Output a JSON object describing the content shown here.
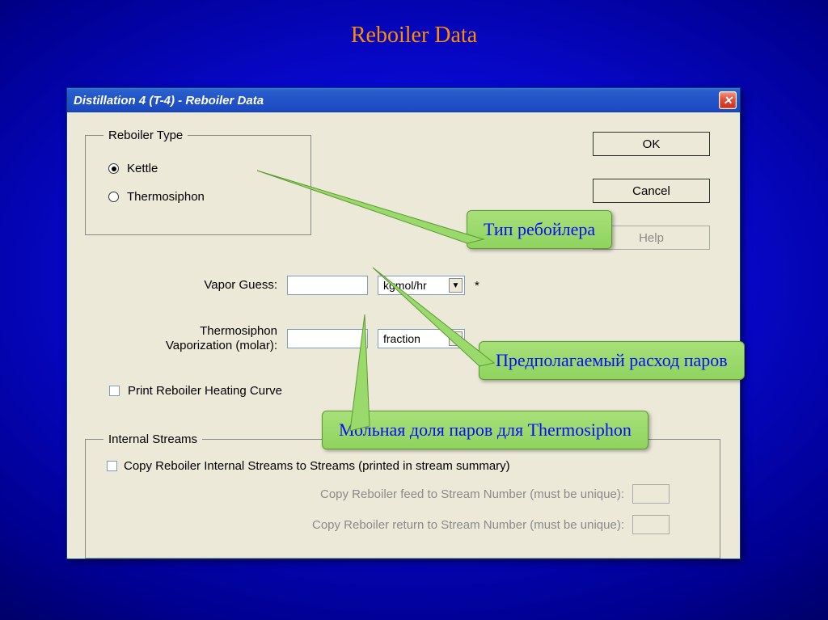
{
  "slide": {
    "title": "Reboiler  Data"
  },
  "window": {
    "title": "Distillation 4 (T-4) - Reboiler Data",
    "buttons": {
      "ok": "OK",
      "cancel": "Cancel",
      "help": "Help"
    },
    "reboiler_type": {
      "legend": "Reboiler Type",
      "kettle": "Kettle",
      "thermosiphon": "Thermosiphon"
    },
    "vapor_guess": {
      "label": "Vapor Guess:",
      "unit_selected": "kgmol/hr",
      "suffix": "*"
    },
    "thermo_vap": {
      "label_line1": "Thermosiphon",
      "label_line2": "Vaporization (molar):",
      "unit_selected": "fraction"
    },
    "print_curve": "Print Reboiler Heating Curve",
    "internal_streams": {
      "legend": "Internal Streams",
      "copy_main": "Copy Reboiler Internal Streams to Streams (printed in stream summary)",
      "copy_feed": "Copy Reboiler feed to Stream Number (must be unique):",
      "copy_return": "Copy Reboiler return to Stream Number (must be unique):"
    }
  },
  "callouts": {
    "type": "Тип ребойлера",
    "vapor": "Предполагаемый расход паров",
    "molar": "Мольная доля паров для Thermosiphon"
  }
}
